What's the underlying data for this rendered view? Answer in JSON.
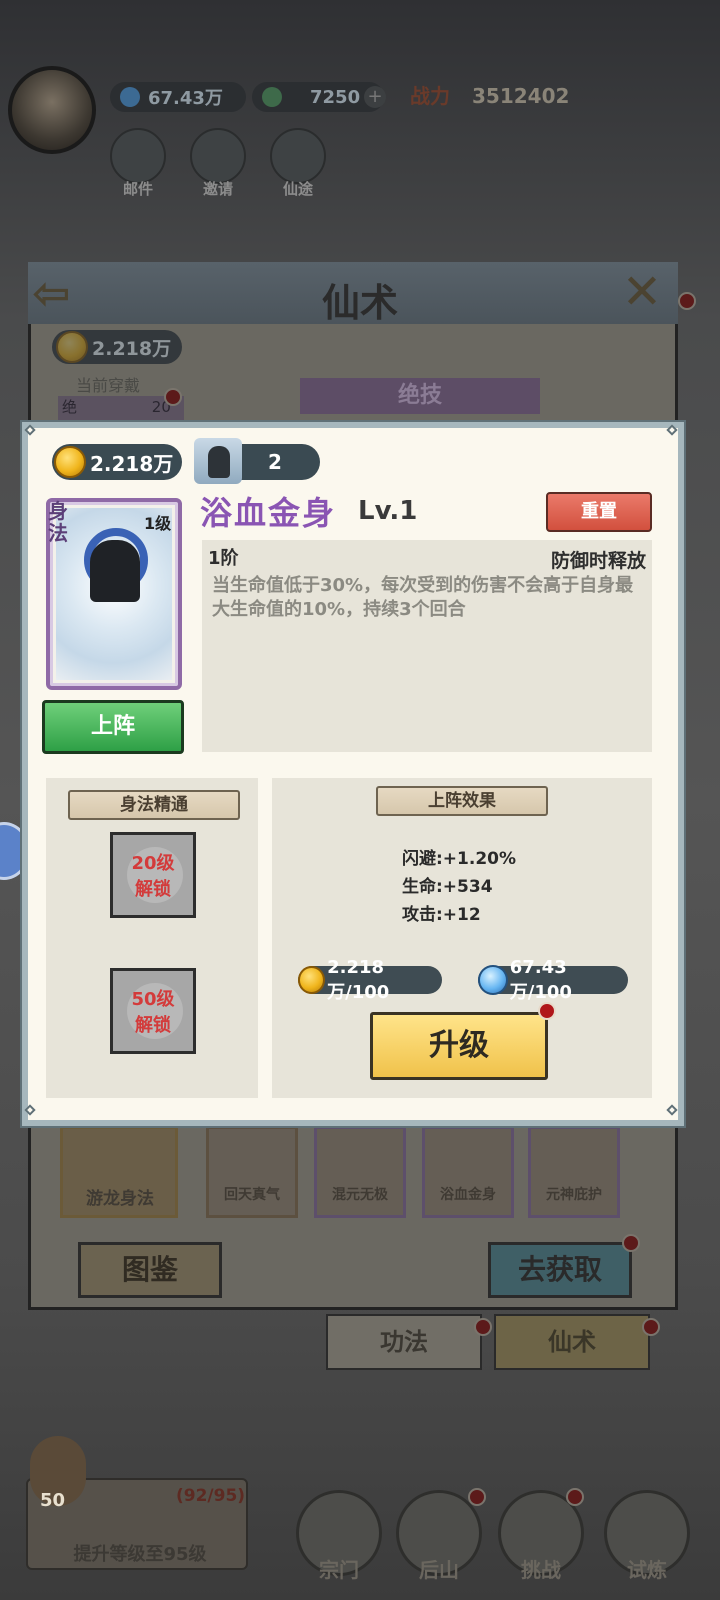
{
  "background": {
    "resources": {
      "spirit_stone": "67.43万",
      "jade": "7250",
      "power_label": "战力",
      "power_value": "3512402"
    },
    "quick_buttons": [
      "邮件",
      "邀请",
      "仙途"
    ],
    "dialog": {
      "title": "仙术",
      "coins": "2.218万",
      "current_equipped_label": "当前穿戴",
      "tab_label": "绝技",
      "jue_label": "绝",
      "jue_level": "20级",
      "skills": [
        "游龙身法",
        "回天真气",
        "混元无极",
        "浴血金身",
        "元神庇护"
      ],
      "codex_button": "图鉴",
      "obtain_button": "去获取"
    },
    "tabs": [
      "功法",
      "仙术"
    ],
    "level_task": {
      "level": "50",
      "progress": "(92/95)",
      "task": "提升等级至95级"
    },
    "bottom_nav": [
      "宗门",
      "后山",
      "挑战",
      "试炼"
    ]
  },
  "popup": {
    "coins": "2.218万",
    "fragment_count": "2",
    "card": {
      "type": "身法",
      "level": "1级"
    },
    "skill_name": "浴血金身",
    "skill_level": "Lv.1",
    "reset_button": "重置",
    "stage": "1阶",
    "trigger": "防御时释放",
    "description": "当生命值低于30%，每次受到的伤害不会高于自身最大生命值的10%，持续3个回合",
    "deploy_button": "上阵",
    "mastery": {
      "title": "身法精通",
      "locks": [
        {
          "level": "20级",
          "status": "解锁"
        },
        {
          "level": "50级",
          "status": "解锁"
        }
      ]
    },
    "effects": {
      "title": "上阵效果",
      "stats": [
        "闪避:+1.20%",
        "生命:+534",
        "攻击:+12"
      ]
    },
    "cost": {
      "coins": "2.218万/100",
      "spirit": "67.43万/100"
    },
    "upgrade_button": "升级"
  },
  "colors": {
    "accent_purple": "#8a55b3",
    "deploy_green": "#2ea046",
    "upgrade_gold": "#f0c24a",
    "reset_red": "#d2503e",
    "lock_red": "#d33b3b"
  }
}
